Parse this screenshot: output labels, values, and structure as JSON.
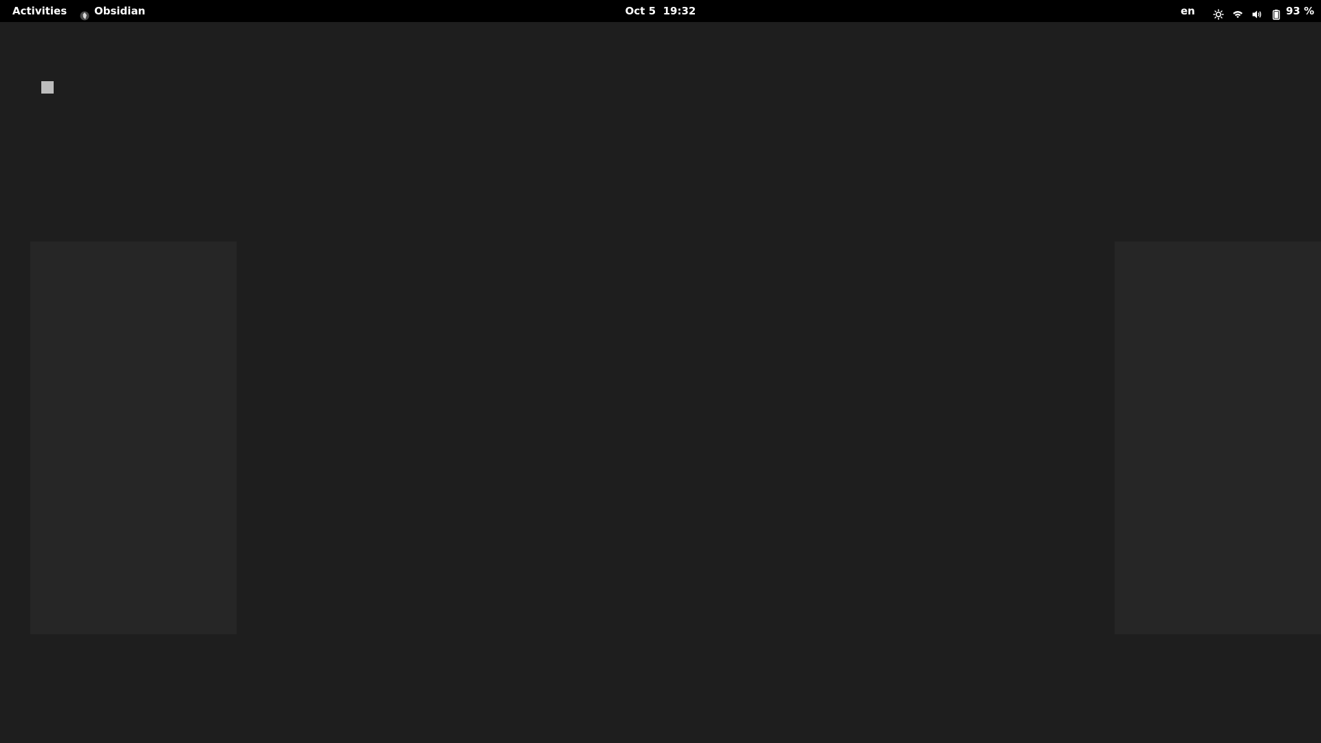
{
  "topbar": {
    "activities_label": "Activities",
    "app_name": "Obsidian",
    "app_icon": "obsidian-icon",
    "clock": "Oct 5  19:32",
    "language": "en",
    "tray": {
      "brightness_icon": "brightness-icon",
      "wifi_icon": "wifi-icon",
      "volume_icon": "volume-icon",
      "battery_icon": "battery-icon",
      "battery_percent": "93 %"
    }
  },
  "colors": {
    "topbar_bg": "#000000",
    "window_bg": "#1e1e1e",
    "panel_placeholder": "#262626",
    "loading_square": "#bdbdbd"
  }
}
